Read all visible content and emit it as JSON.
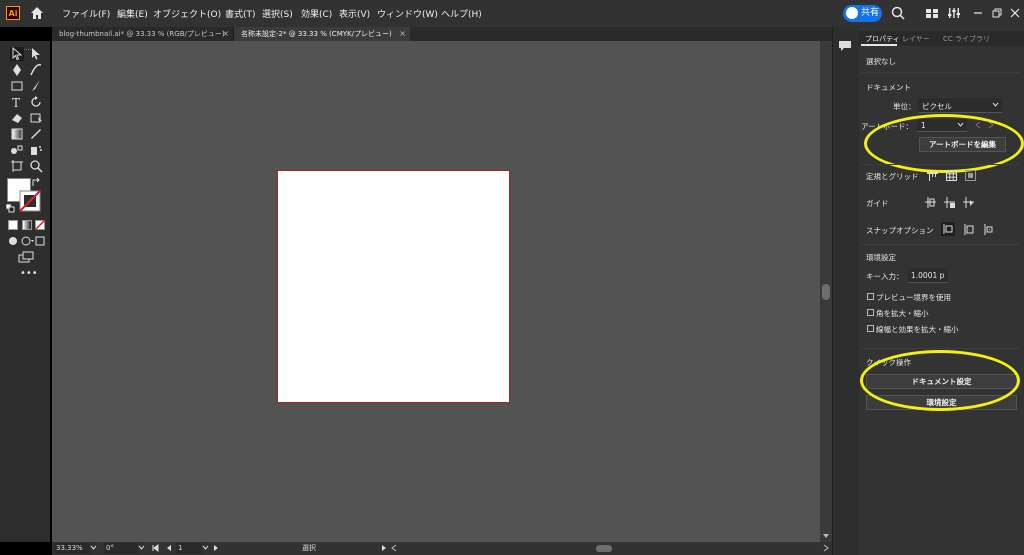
{
  "app": {
    "logo_text": "Ai"
  },
  "menu": [
    "ファイル(F)",
    "編集(E)",
    "オブジェクト(O)",
    "書式(T)",
    "選択(S)",
    "効果(C)",
    "表示(V)",
    "ウィンドウ(W)",
    "ヘルプ(H)"
  ],
  "share_label": "共有",
  "tabs": [
    {
      "label": "blog-thumbnail.ai* @ 33.33 % (RGB/プレビュー)",
      "close": "×"
    },
    {
      "label": "名称未設定-2* @ 33.33 % (CMYK/プレビュー)",
      "close": "×"
    }
  ],
  "status": {
    "zoom": "33.33%",
    "rotation": "0°",
    "artboard": "1",
    "tool": "選択"
  },
  "panel": {
    "tabs": [
      "プロパティ",
      "レイヤー",
      "CC ライブラリ"
    ],
    "selection": "選択なし",
    "document_header": "ドキュメント",
    "units_label": "単位：",
    "units_value": "ピクセル",
    "artboard_label": "アートボード：",
    "artboard_value": "1",
    "edit_artboard_button": "アートボードを編集",
    "rulers_grids_label": "定規とグリッド",
    "guides_label": "ガイド",
    "snap_label": "スナップオプション",
    "prefs_header": "環境設定",
    "key_input_label": "キー入力：",
    "key_input_value": "1.0001 p",
    "checkbox_preview_bounds": "プレビュー境界を使用",
    "checkbox_scale_corners": "角を拡大・縮小",
    "checkbox_scale_strokes": "線幅と効果を拡大・縮小",
    "quick_actions_header": "クイック操作",
    "document_setup_button": "ドキュメント設定",
    "preferences_button": "環境設定"
  },
  "colors": {
    "accent_blue": "#1473e6",
    "highlight_yellow": "#f2f20a",
    "artboard_border": "#b02020",
    "canvas": "#535353"
  }
}
